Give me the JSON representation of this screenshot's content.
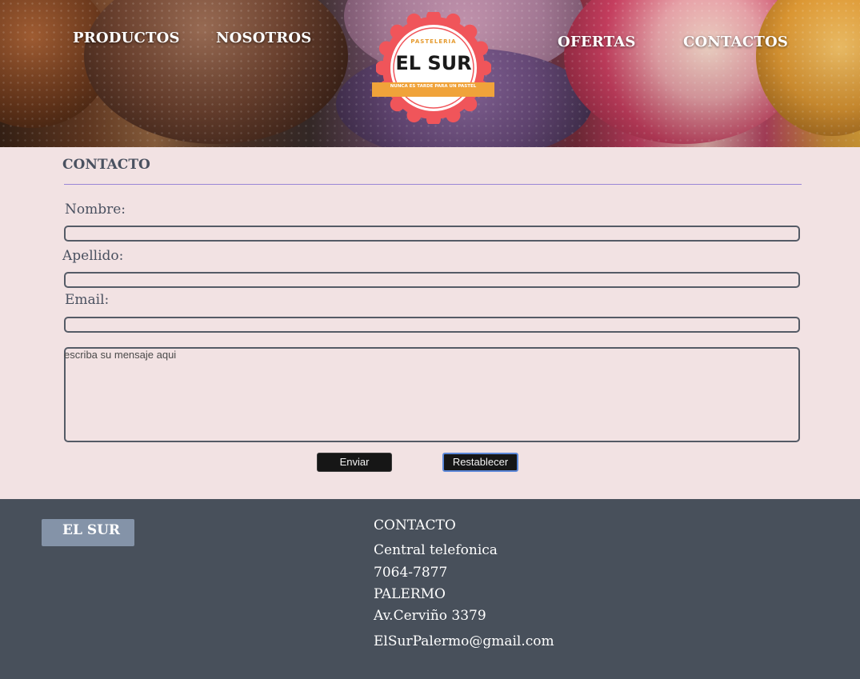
{
  "nav": {
    "left": [
      "PRODUCTOS",
      "NOSOTROS"
    ],
    "right": [
      "OFERTAS",
      "CONTACTOS"
    ]
  },
  "logo": {
    "top_text": "PASTELERIA",
    "name": "EL SUR",
    "slogan": "NUNCA ES TARDE PARA UN PASTEL"
  },
  "form": {
    "title": "CONTACTO",
    "nombre_label": "Nombre:",
    "nombre_value": "",
    "apellido_label": "Apellido:",
    "apellido_value": "",
    "email_label": "Email:",
    "email_value": "",
    "message_placeholder": "escriba su mensaje aqui",
    "submit_label": "Enviar",
    "reset_label": "Restablecer"
  },
  "footer": {
    "brand": "EL SUR",
    "contact_title": "CONTACTO",
    "phone_label": "Central telefonica",
    "phone": "7064-7877",
    "neighborhood": "PALERMO",
    "address": "Av.Cerviño 3379",
    "email": "ElSurPalermo@gmail.com"
  },
  "colors": {
    "page_bg": "#f2e2e3",
    "footer_bg": "#48505b",
    "footer_brand_bg": "#8493a8",
    "divider": "#9a86d6",
    "logo_red": "#f0555a",
    "logo_orange": "#f0a33a"
  }
}
